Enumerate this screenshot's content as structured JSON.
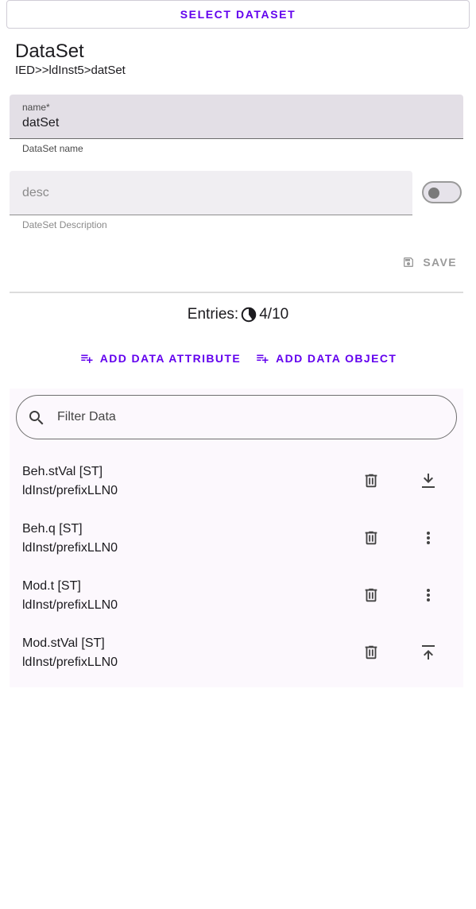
{
  "select_dataset_label": "Select DataSet",
  "header": {
    "title": "DataSet",
    "path": "IED>>ldInst5>datSet"
  },
  "form": {
    "name_label": "name*",
    "name_value": "datSet",
    "name_helper": "DataSet name",
    "desc_placeholder": "desc",
    "desc_helper": "DateSet Description",
    "desc_toggle_on": false,
    "save_label": "SAVE"
  },
  "entries": {
    "label": "Entries:",
    "count": "4/10",
    "fraction": 0.4
  },
  "actions": {
    "add_attribute": "Add Data Attribute",
    "add_object": "Add Data Object"
  },
  "filter": {
    "placeholder": "Filter Data"
  },
  "items": [
    {
      "name": "Beh.stVal [ST]",
      "path": "ldInst/prefixLLN0",
      "action_icon": "move-down-icon"
    },
    {
      "name": "Beh.q [ST]",
      "path": "ldInst/prefixLLN0",
      "action_icon": "more-vert-icon"
    },
    {
      "name": "Mod.t [ST]",
      "path": "ldInst/prefixLLN0",
      "action_icon": "more-vert-icon"
    },
    {
      "name": "Mod.stVal [ST]",
      "path": "ldInst/prefixLLN0",
      "action_icon": "move-up-icon"
    }
  ],
  "colors": {
    "accent": "#6200ee",
    "panel": "#fcf8fd"
  }
}
